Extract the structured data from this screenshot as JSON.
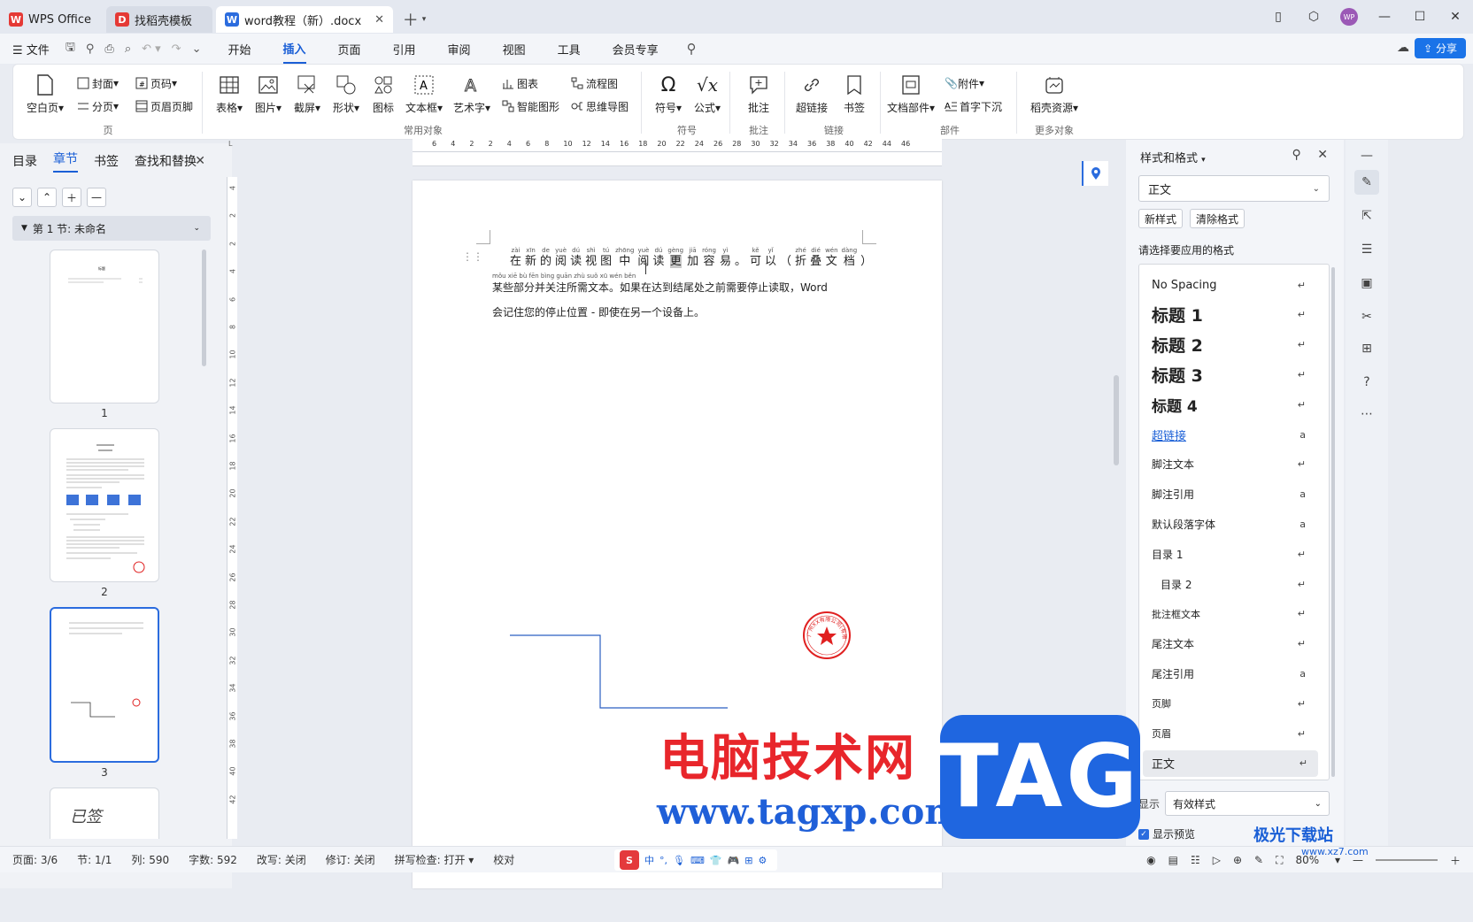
{
  "titlebar": {
    "tabs": [
      {
        "label": "WPS Office",
        "icon": "wps-logo-icon"
      },
      {
        "label": "找稻壳模板",
        "icon": "docer-logo-icon"
      },
      {
        "label": "word教程（新）.docx",
        "icon": "word-doc-icon"
      }
    ]
  },
  "menubar": {
    "file_label": "文件",
    "tabs": [
      "开始",
      "插入",
      "页面",
      "引用",
      "审阅",
      "视图",
      "工具",
      "会员专享"
    ],
    "active_tab": "插入",
    "share_label": "分享"
  },
  "ribbon": {
    "groups": [
      {
        "label": "页",
        "items": [
          "空白页",
          "封面",
          "分页",
          "页码",
          "页眉页脚"
        ]
      },
      {
        "label": "常用对象",
        "items": [
          "表格",
          "图片",
          "截屏",
          "形状",
          "图标",
          "文本框",
          "艺术字",
          "图表",
          "智能图形",
          "流程图",
          "思维导图"
        ]
      },
      {
        "label": "符号",
        "items": [
          "符号",
          "公式"
        ]
      },
      {
        "label": "批注",
        "items": [
          "批注"
        ]
      },
      {
        "label": "链接",
        "items": [
          "超链接",
          "书签"
        ]
      },
      {
        "label": "部件",
        "items": [
          "文档部件",
          "附件",
          "首字下沉"
        ]
      },
      {
        "label": "更多对象",
        "items": [
          "稻壳资源"
        ]
      }
    ]
  },
  "leftpanel": {
    "tabs": [
      "目录",
      "章节",
      "书签",
      "查找和替换"
    ],
    "active_tab": "章节",
    "section_label": "第 1 节: 未命名",
    "thumbnails": [
      "1",
      "2",
      "3"
    ],
    "thumb1_title": "标题",
    "thumb4_text": "已签"
  },
  "rulers": {
    "horizontal": [
      "6",
      "4",
      "2",
      "2",
      "4",
      "6",
      "8",
      "10",
      "12",
      "14",
      "16",
      "18",
      "20",
      "22",
      "24",
      "26",
      "28",
      "30",
      "32",
      "34",
      "36",
      "38",
      "40",
      "42",
      "44",
      "46"
    ],
    "vertical": [
      "4",
      "2",
      "2",
      "4",
      "6",
      "8",
      "10",
      "12",
      "14",
      "16",
      "18",
      "20",
      "22",
      "24",
      "26",
      "28",
      "30",
      "32",
      "34",
      "36",
      "38",
      "40",
      "42"
    ]
  },
  "document": {
    "ruby_line": [
      {
        "py": "zài",
        "hz": "在"
      },
      {
        "py": "xīn",
        "hz": "新"
      },
      {
        "py": "de",
        "hz": "的"
      },
      {
        "py": "yuè",
        "hz": "阅"
      },
      {
        "py": "dú",
        "hz": "读"
      },
      {
        "py": "shì",
        "hz": "视"
      },
      {
        "py": "tú",
        "hz": "图"
      },
      {
        "py": "zhōng",
        "hz": "中"
      },
      {
        "py": "yuè",
        "hz": "阅"
      },
      {
        "py": "dú",
        "hz": "读"
      },
      {
        "py": "gèng",
        "hz": "更"
      },
      {
        "py": "jiā",
        "hz": "加"
      },
      {
        "py": "róng",
        "hz": "容"
      },
      {
        "py": "yì",
        "hz": "易"
      },
      {
        "py": "",
        "hz": "。"
      },
      {
        "py": "kě",
        "hz": "可"
      },
      {
        "py": "yǐ",
        "hz": "以"
      },
      {
        "py": "",
        "hz": "（"
      },
      {
        "py": "zhé",
        "hz": "折"
      },
      {
        "py": "dié",
        "hz": "叠"
      },
      {
        "py": "wén",
        "hz": "文"
      },
      {
        "py": "dàng",
        "hz": "档"
      },
      {
        "py": "",
        "hz": "）"
      }
    ],
    "line2_pinyin": "mǒu xiē bù fēn bìng guān zhù suǒ xū wén běn",
    "line2": "某些部分并关注所需文本。如果在达到结尾处之前需要停止读取，Word",
    "line3": "会记住您的停止位置 - 即使在另一个设备上。",
    "stamp_text": "广州XX有限公司(有限公司)"
  },
  "stylepanel": {
    "title": "样式和格式",
    "current_style": "正文",
    "new_style_label": "新样式",
    "clear_format_label": "清除格式",
    "prompt": "请选择要应用的格式",
    "styles": [
      {
        "name": "No Spacing",
        "kind": "normal"
      },
      {
        "name": "标题 1",
        "kind": "h"
      },
      {
        "name": "标题 2",
        "kind": "h"
      },
      {
        "name": "标题 3",
        "kind": "h"
      },
      {
        "name": "标题 4",
        "kind": "h4"
      },
      {
        "name": "超链接",
        "kind": "link"
      },
      {
        "name": "脚注文本",
        "kind": "small"
      },
      {
        "name": "脚注引用",
        "kind": "small"
      },
      {
        "name": "默认段落字体",
        "kind": "small"
      },
      {
        "name": "目录 1",
        "kind": "small"
      },
      {
        "name": "目录 2",
        "kind": "indent"
      },
      {
        "name": "批注框文本",
        "kind": "tiny"
      },
      {
        "name": "尾注文本",
        "kind": "small"
      },
      {
        "name": "尾注引用",
        "kind": "small"
      },
      {
        "name": "页脚",
        "kind": "tiny"
      },
      {
        "name": "页眉",
        "kind": "tiny"
      },
      {
        "name": "正文",
        "kind": "selected"
      }
    ],
    "show_label": "显示",
    "show_value": "有效样式",
    "preview_label": "显示预览"
  },
  "statusbar": {
    "page": "页面: 3/6",
    "section": "节: 1/1",
    "column": "列: 590",
    "words": "字数: 592",
    "revision_mode": "改写: 关闭",
    "track_changes": "修订: 关闭",
    "spell_check": "拼写检查: 打开",
    "proofread": "校对",
    "ime_lang": "中",
    "zoom": "80%"
  },
  "watermark": {
    "cn": "电脑技术网",
    "url": "www.tagxp.com",
    "tag": "TAG",
    "xz": "极光下载站",
    "xz_url": "www.xz7.com"
  },
  "colors": {
    "accent": "#1a5fd6",
    "share": "#1a73e8",
    "stamp": "#e02020",
    "wm_red": "#e8262b",
    "wm_blue": "#1f66e0"
  }
}
